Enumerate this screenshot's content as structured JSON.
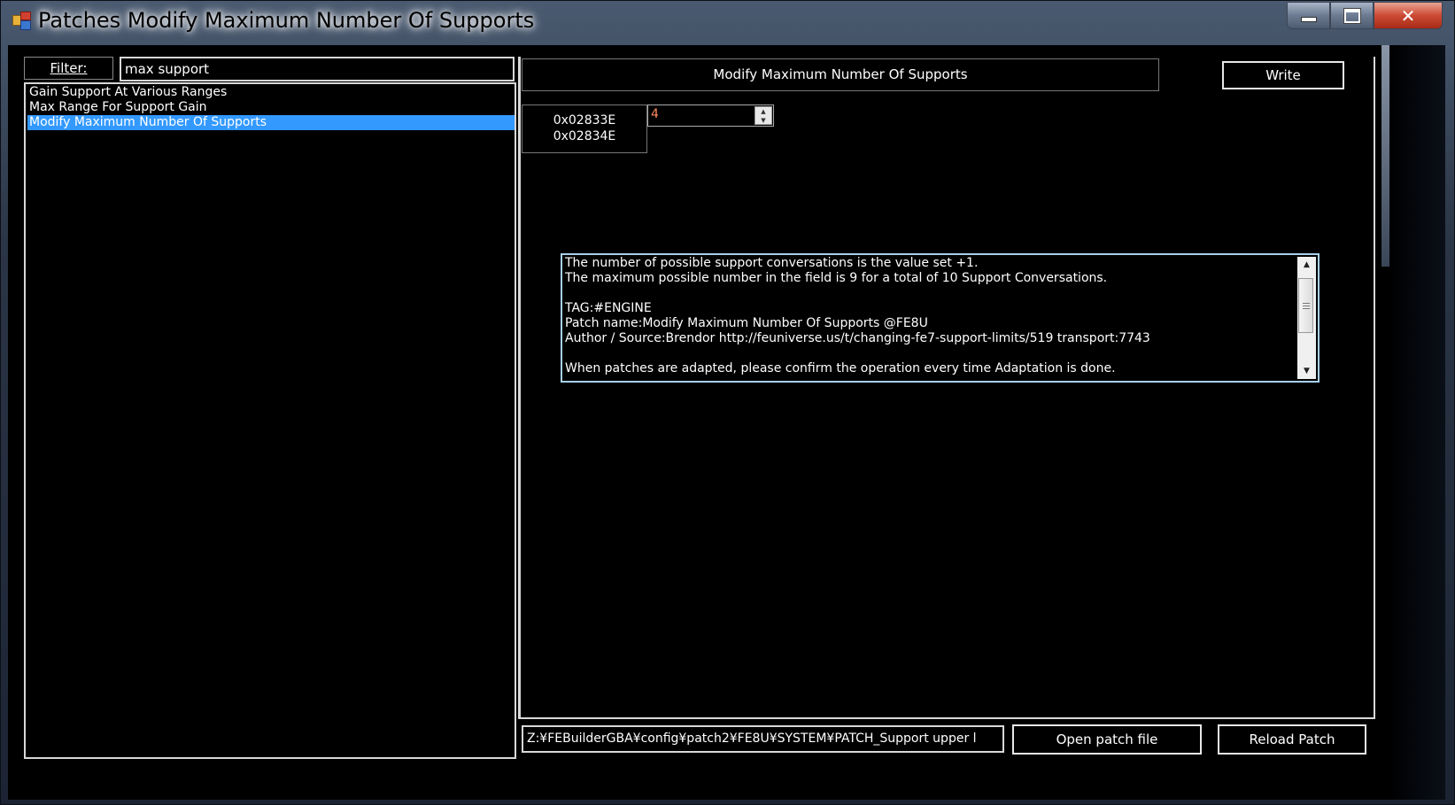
{
  "window": {
    "title": "Patches Modify Maximum Number Of Supports"
  },
  "filter": {
    "label": "Filter:",
    "value": "max support"
  },
  "patch_list": {
    "items": [
      {
        "label": "Gain Support At Various Ranges",
        "selected": false
      },
      {
        "label": "Max Range For Support Gain",
        "selected": false
      },
      {
        "label": "Modify Maximum Number Of Supports",
        "selected": true
      }
    ]
  },
  "detail": {
    "patch_title": "Modify Maximum Number Of Supports",
    "write_label": "Write",
    "addresses": [
      "0x02833E",
      "0x02834E"
    ],
    "value": "4",
    "description_lines": [
      "The number of possible support conversations is the value set +1.",
      "The maximum possible number in the field is 9 for a total of 10 Support Conversations.",
      "",
      "TAG:#ENGINE",
      "Patch name:Modify Maximum Number Of Supports  @FE8U",
      "Author / Source:Brendor http://feuniverse.us/t/changing-fe7-support-limits/519  transport:7743",
      "",
      "When patches are adapted, please confirm the operation every time Adaptation is done."
    ]
  },
  "bottom": {
    "path": "Z:¥FEBuilderGBA¥config¥patch2¥FE8U¥SYSTEM¥PATCH_Support upper l",
    "open_label": "Open patch file",
    "reload_label": "Reload Patch"
  },
  "colors": {
    "selection": "#3399ff",
    "value_text": "#ff8a5c",
    "background": "#000000",
    "foreground": "#ffffff"
  }
}
